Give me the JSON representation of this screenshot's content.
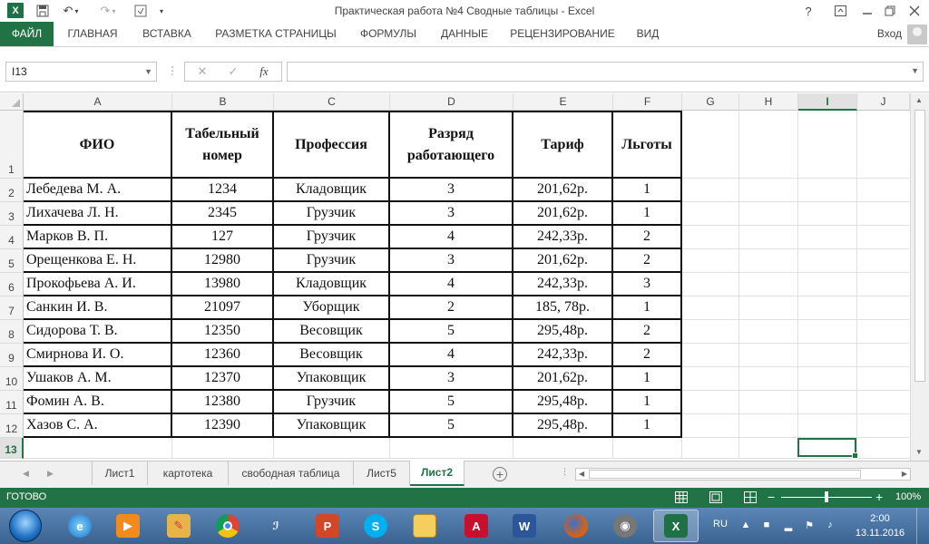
{
  "titlebar": {
    "app_logo": "X",
    "title": "Практическая работа №4 Сводные таблицы - Excel",
    "icons": [
      "save-icon",
      "undo-icon",
      "redo-icon",
      "customize-icon",
      "help-icon",
      "ribbon-display-icon",
      "minimize-icon",
      "restore-icon",
      "close-icon"
    ],
    "help": "?"
  },
  "ribbon": {
    "tabs": [
      "ФАЙЛ",
      "ГЛАВНАЯ",
      "ВСТАВКА",
      "РАЗМЕТКА СТРАНИЦЫ",
      "ФОРМУЛЫ",
      "ДАННЫЕ",
      "РЕЦЕНЗИРОВАНИЕ",
      "ВИД"
    ],
    "login": "Вход"
  },
  "formula_bar": {
    "name_box": "I13",
    "cancel": "✕",
    "enter": "✓",
    "fx": "fx",
    "value": ""
  },
  "columns": [
    "A",
    "B",
    "C",
    "D",
    "E",
    "F",
    "G",
    "H",
    "I",
    "J"
  ],
  "selected_column": "I",
  "selected_row": "13",
  "rows": [
    "1",
    "2",
    "3",
    "4",
    "5",
    "6",
    "7",
    "8",
    "9",
    "10",
    "11",
    "12",
    "13"
  ],
  "table": {
    "headers": [
      "ФИО",
      "Табельный номер",
      "Профессия",
      "Разряд работающего",
      "Тариф",
      "Льготы"
    ],
    "rows": [
      [
        "Лебедева М. А.",
        "1234",
        "Кладовщик",
        "3",
        "201,62р.",
        "1"
      ],
      [
        "Лихачева Л. Н.",
        "2345",
        "Грузчик",
        "3",
        "201,62р.",
        "1"
      ],
      [
        "Марков В. П.",
        "127",
        "Грузчик",
        "4",
        "242,33р.",
        "2"
      ],
      [
        "Орещенкова Е. Н.",
        "12980",
        "Грузчик",
        "3",
        "201,62р.",
        "2"
      ],
      [
        "Прокофьева А. И.",
        "13980",
        "Кладовщик",
        "4",
        "242,33р.",
        "3"
      ],
      [
        "Санкин И. В.",
        "21097",
        "Уборщик",
        "2",
        "185, 78р.",
        "1"
      ],
      [
        "Сидорова Т. В.",
        "12350",
        "Весовщик",
        "5",
        "295,48р.",
        "2"
      ],
      [
        "Смирнова И. О.",
        "12360",
        "Весовщик",
        "4",
        "242,33р.",
        "2"
      ],
      [
        "Ушаков А. М.",
        "12370",
        "Упаковщик",
        "3",
        "201,62р.",
        "1"
      ],
      [
        "Фомин А. В.",
        "12380",
        "Грузчик",
        "5",
        "295,48р.",
        "1"
      ],
      [
        "Хазов С. А.",
        "12390",
        "Упаковщик",
        "5",
        "295,48р.",
        "1"
      ]
    ]
  },
  "sheets": {
    "tabs": [
      "Лист1",
      "картотека",
      "свободная таблица",
      "Лист5",
      "Лист2"
    ],
    "active": "Лист2",
    "add": "+"
  },
  "statusbar": {
    "status": "ГОТОВО",
    "zoom": "100%",
    "zoom_minus": "−",
    "zoom_plus": "+"
  },
  "taskbar": {
    "apps": [
      "ie-icon",
      "media-player-icon",
      "paint-icon",
      "chrome-icon",
      "app-icon",
      "powerpoint-icon",
      "skype-icon",
      "explorer-icon",
      "acrobat-icon",
      "word-icon",
      "firefox-icon",
      "video-icon",
      "excel-icon"
    ],
    "lang": "RU",
    "time": "2:00",
    "date": "13.11.2016"
  },
  "colors": {
    "excel_green": "#217346",
    "taskbar": "#3a6391"
  }
}
